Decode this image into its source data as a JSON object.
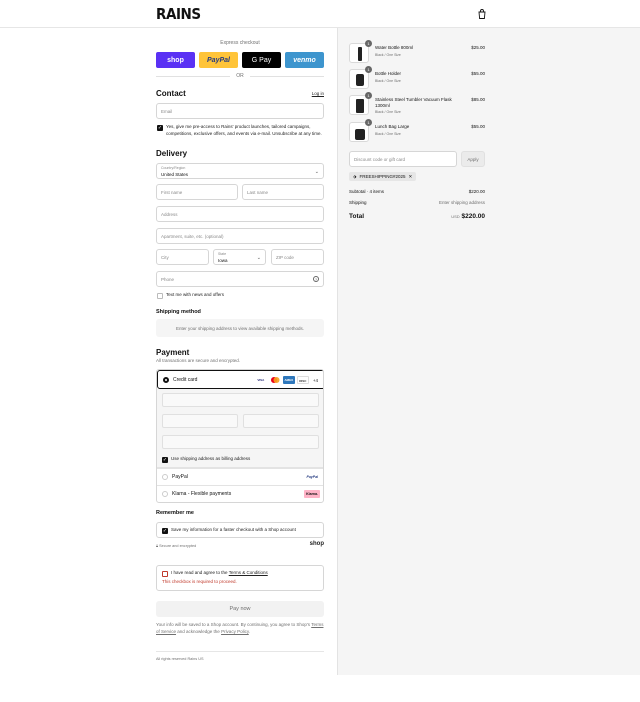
{
  "brand": "RAINS",
  "express": {
    "label": "Express checkout",
    "buttons": [
      "shop",
      "PayPal",
      "G Pay",
      "venmo"
    ],
    "or": "OR"
  },
  "contact": {
    "title": "Contact",
    "login": "Log in",
    "email_placeholder": "Email",
    "consent": "Yes, give me pre-access to Rains' product launches, tailored campaigns, competitions, exclusive offers, and events via e-mail. Unsubscribe at any time."
  },
  "delivery": {
    "title": "Delivery",
    "country_label": "Country/Region",
    "country_value": "United States",
    "first_name": "First name",
    "last_name": "Last name",
    "address": "Address",
    "apartment": "Apartment, suite, etc. (optional)",
    "city": "City",
    "state_label": "State",
    "state_value": "Iowa",
    "zip": "ZIP code",
    "phone": "Phone",
    "text_me": "Text me with news and offers"
  },
  "shipping": {
    "title": "Shipping method",
    "note": "Enter your shipping address to view available shipping methods."
  },
  "payment": {
    "title": "Payment",
    "subtitle": "All transactions are secure and encrypted.",
    "credit_card": "Credit card",
    "card_logos": [
      "VISA",
      "MC",
      "AMEX",
      "DISC"
    ],
    "more_cards": "+4",
    "billing": "Use shipping address as billing address",
    "paypal": "PayPal",
    "paypal_logo": "PayPal",
    "klarna": "Klarna - Flexible payments",
    "klarna_logo": "Klarna."
  },
  "remember": {
    "title": "Remember me",
    "save": "Save my information for a faster checkout with a Shop account",
    "secure": "Secure and encrypted",
    "shop": "shop"
  },
  "terms": {
    "text_prefix": "I have read and agree to the ",
    "link": "Terms & Conditions",
    "error": "This checkbox is required to proceed."
  },
  "pay_now": "Pay now",
  "disclaimer": {
    "p1": "Your info will be saved to a Shop account. By continuing, you agree to Shop's ",
    "tos": "Terms of Service",
    "p2": " and acknowledge the ",
    "privacy": "Privacy Policy",
    "p3": "."
  },
  "footer": "All rights reserved Rains US",
  "cart": {
    "items": [
      {
        "name": "Water Bottle 800ml",
        "variant": "Black / One Size",
        "price": "$25.00",
        "qty": "1"
      },
      {
        "name": "Bottle Holder",
        "variant": "Black / One Size",
        "price": "$55.00",
        "qty": "1"
      },
      {
        "name": "Stainless Steel Tumbler Vacuum Flask 1300ml",
        "variant": "Black / One Size",
        "price": "$85.00",
        "qty": "1"
      },
      {
        "name": "Lunch Bag Large",
        "variant": "Black / One Size",
        "price": "$55.00",
        "qty": "1"
      }
    ],
    "discount_placeholder": "Discount code or gift card",
    "apply": "Apply",
    "code": "FREESHIPPING#2025",
    "subtotal_label": "Subtotal · 4 items",
    "subtotal": "$220.00",
    "shipping_label": "Shipping",
    "shipping_value": "Enter shipping address",
    "total_label": "Total",
    "currency": "USD",
    "total": "$220.00"
  },
  "colors": {
    "shop": "#5a31f4",
    "paypal": "#ffc439",
    "gpay": "#000000",
    "venmo": "#3d95ce",
    "error": "#c0392b"
  }
}
